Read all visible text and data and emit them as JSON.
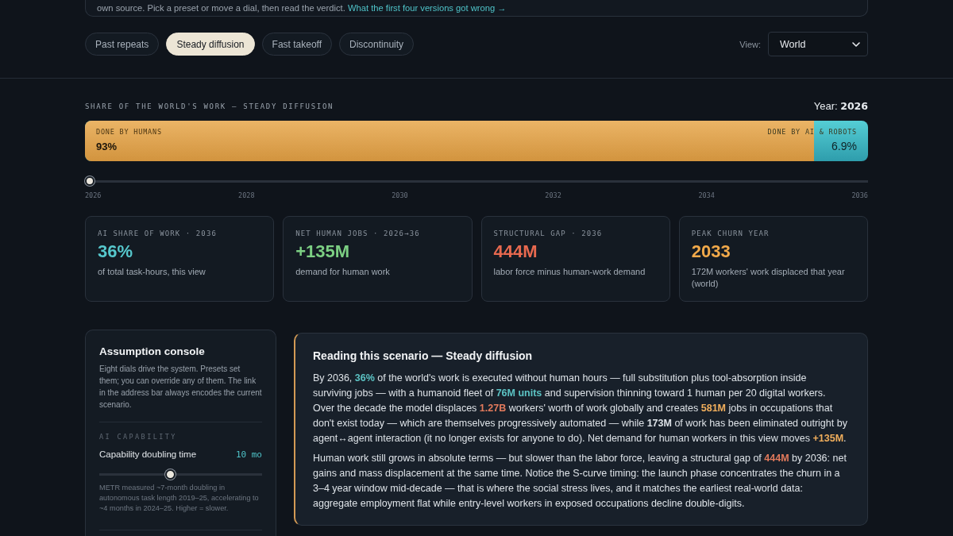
{
  "intro": {
    "text": "own source. Pick a preset or move a dial, then read the verdict.",
    "link": "What the first four versions got wrong →"
  },
  "presets": [
    {
      "label": "Past repeats",
      "selected": false
    },
    {
      "label": "Steady diffusion",
      "selected": true
    },
    {
      "label": "Fast takeoff",
      "selected": false
    },
    {
      "label": "Discontinuity",
      "selected": false
    }
  ],
  "view": {
    "label": "View:",
    "value": "World"
  },
  "share_bar": {
    "title": "SHARE OF THE WORLD'S WORK — STEADY DIFFUSION",
    "year_label": "Year:",
    "year": "2026",
    "humans_label": "DONE BY HUMANS",
    "humans_value": "93%",
    "ai_label": "DONE BY AI & ROBOTS",
    "ai_value": "6.9%",
    "level": 0.931
  },
  "timeline": {
    "level": 0,
    "ticks": [
      "2026",
      "2028",
      "2030",
      "2032",
      "2034",
      "2036"
    ]
  },
  "stats": [
    {
      "label": "AI SHARE OF WORK · 2036",
      "value": "36%",
      "note": "of total task-hours, this view",
      "color": "#56c7cc"
    },
    {
      "label": "NET HUMAN JOBS · 2026→36",
      "value": "+135M",
      "note": "demand for human work",
      "color": "#7ccf83"
    },
    {
      "label": "STRUCTURAL GAP · 2036",
      "value": "444M",
      "note": "labor force minus human-work demand",
      "color": "#e8694f"
    },
    {
      "label": "PEAK CHURN YEAR",
      "value": "2033",
      "note": "172M workers' work displaced that year (world)",
      "color": "#f1a94a"
    }
  ],
  "console": {
    "title": "Assumption console",
    "description": "Eight dials drive the system. Presets set them; you can override any of them. The link in the address bar always encodes the current scenario.",
    "sections": [
      {
        "heading": "AI CAPABILITY",
        "dials": [
          {
            "name": "Capability doubling time",
            "reading": "10 mo",
            "level": 0.43,
            "note": "METR measured ~7-month doubling in autonomous task length 2019–25, accelerating to ~4 months in 2024–25. Higher = slower."
          }
        ]
      }
    ]
  },
  "reading": {
    "title": "Reading this scenario — Steady diffusion",
    "paragraphs": [
      [
        {
          "text": "By 2036, "
        },
        {
          "text": "36%",
          "color": "#5cc3c4"
        },
        {
          "text": " of the world's work is executed without human hours — full substitution plus tool-absorption inside surviving jobs — with a humanoid fleet of "
        },
        {
          "text": "76M units",
          "color": "#5cc3c4"
        },
        {
          "text": " and supervision thinning toward 1 human per 20 digital workers. Over the decade the model displaces "
        },
        {
          "text": "1.27B",
          "color": "#e27a5c"
        },
        {
          "text": " workers' worth of work globally and creates "
        },
        {
          "text": "581M",
          "color": "#f0ae5c"
        },
        {
          "text": " jobs in occupations that don't exist today — which are themselves progressively automated — while **173M** of work has been eliminated outright by agent↔agent interaction (it no longer exists for anyone to do). Net demand for human workers in this view moves "
        },
        {
          "text": "+135M",
          "color": "#f0ae5c"
        },
        {
          "text": "."
        }
      ],
      [
        {
          "text": "Human work still grows in absolute terms — but slower than the labor force, leaving a structural gap of "
        },
        {
          "text": "444M",
          "color": "#e27a5c"
        },
        {
          "text": " by 2036: net gains and mass displacement at the same time. Notice the S-curve timing: the launch phase concentrates the churn in a 3–4 year window mid-decade — that is where the social stress lives, and it matches the earliest real-world data: aggregate employment flat while entry-level workers in exposed occupations decline double-digits."
        }
      ]
    ]
  }
}
